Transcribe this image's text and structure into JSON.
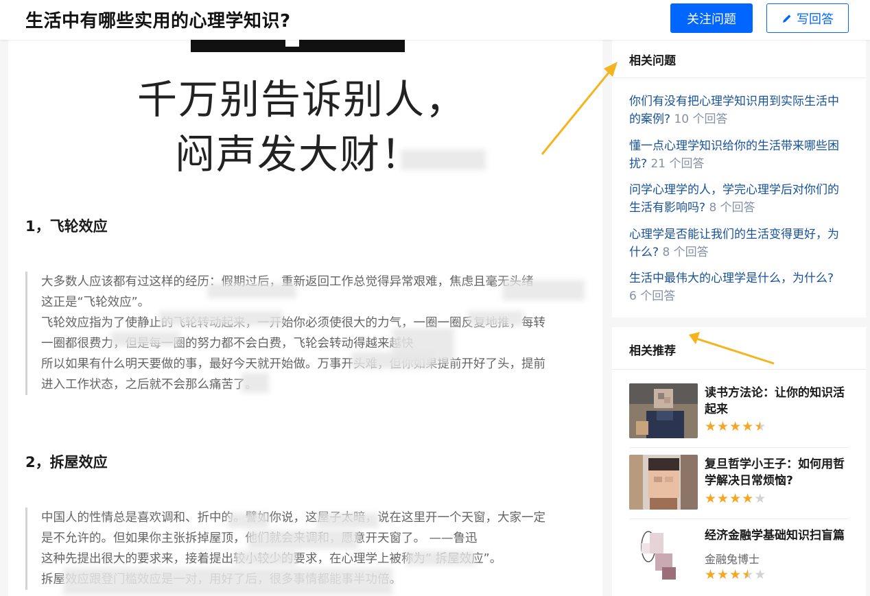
{
  "header": {
    "question_title": "生活中有哪些实用的心理学知识?",
    "follow_label": "关注问题",
    "answer_label": "写回答"
  },
  "answer": {
    "image_text_line1": "千万别告诉别人，",
    "image_text_line2": "闷声发大财！",
    "sections": [
      {
        "heading": "1，飞轮效应",
        "lines": [
          "大多数人应该都有过这样的经历：假期过后，重新返回工作总觉得异常艰难，焦虑且毫无头绪",
          "这正是“飞轮效应”。",
          "飞轮效应指为了使静止的飞轮转动起来，一开始你必须使很大的力气，一圈一圈反复地推，每转",
          "一圈都很费力，但是每一圈的努力都不会白费，飞轮会转动得越来越快",
          "所以如果有什么明天要做的事，最好今天就开始做。万事开头难，但你如果提前开好了头，提前",
          "进入工作状态，之后就不会那么痛苦了。"
        ]
      },
      {
        "heading": "2，拆屋效应",
        "lines": [
          "中国人的性情总是喜欢调和、折中的。譬如你说，这屋子太暗，说在这里开一个天窗，大家一定",
          "是不允许的。但如果你主张拆掉屋顶，他们就会来调和，愿意开天窗了。 ——鲁迅",
          "这种先提出很大的要求来，接着提出较小较少的要求，在心理学上被称为“ 拆屋效应”。",
          "拆屋效应跟登门槛效应是一对，用好了后，很多事情都能事半功倍。"
        ]
      }
    ]
  },
  "related_questions": {
    "title": "相关问题",
    "items": [
      {
        "line1": "你们有没有把心理学知识用到实际生活中",
        "line2": "的案例?",
        "count": "10 个回答"
      },
      {
        "line1": "懂一点心理学知识给你的生活带来哪些困",
        "line2": "扰?",
        "count": "21 个回答"
      },
      {
        "line1": "问学心理学的人，学完心理学后对你们的",
        "line2": "生活有影响吗?",
        "count": "8 个回答"
      },
      {
        "line1": "心理学是否能让我们的生活变得更好，为",
        "line2": "什么?",
        "count": "8 个回答"
      },
      {
        "line1": "生活中最伟大的心理学是什么，为什么?",
        "line2": "",
        "count": "6 个回答"
      }
    ]
  },
  "recommendations": {
    "title": "相关推荐",
    "items": [
      {
        "title": "读书方法论：让你的知识活起来",
        "subtitle": "",
        "rating": 4.5
      },
      {
        "title": "复旦哲学小王子：如何用哲学解决日常烦恼?",
        "subtitle": "",
        "rating": 4
      },
      {
        "title": "经济金融学基础知识扫盲篇",
        "subtitle": "金融兔博士",
        "rating": 3.5
      }
    ]
  },
  "colors": {
    "brand_blue": "#0066ff",
    "link_blue": "#175199",
    "star_orange": "#f5a623",
    "annotation_arrow": "#f5b41e"
  },
  "icons": {
    "pencil": "pencil-icon",
    "star": "star-icon"
  }
}
